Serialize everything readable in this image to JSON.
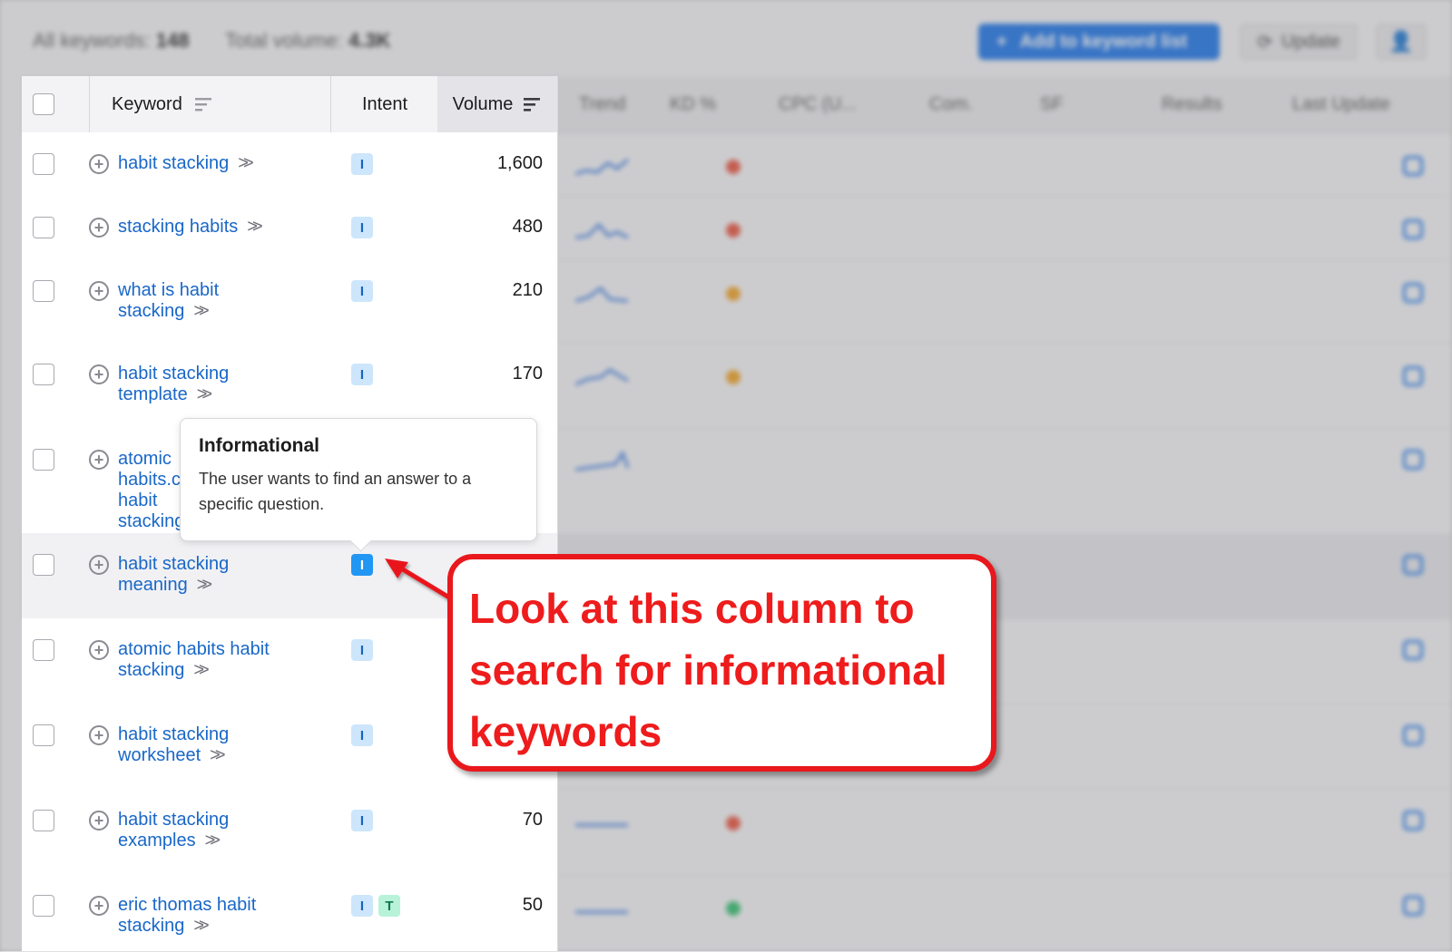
{
  "summary": {
    "label_keywords": "All keywords:",
    "value_keywords": "148",
    "label_volume": "Total volume:",
    "value_volume": "4.3K"
  },
  "toolbar": {
    "add_label": "Add to keyword list",
    "update_label": "Update"
  },
  "columns": {
    "keyword": "Keyword",
    "intent": "Intent",
    "volume": "Volume",
    "blurred": [
      "Trend",
      "KD %",
      "CPC (U...",
      "Com.",
      "SF",
      "Results",
      "Last Update"
    ]
  },
  "rows": [
    {
      "keyword": "habit stacking",
      "intents": [
        "I"
      ],
      "volume": "1,600"
    },
    {
      "keyword": "stacking habits",
      "intents": [
        "I"
      ],
      "volume": "480"
    },
    {
      "keyword": "what is habit stacking",
      "intents": [
        "I"
      ],
      "volume": "210"
    },
    {
      "keyword": "habit stacking template",
      "intents": [
        "I"
      ],
      "volume": "170"
    },
    {
      "keyword": "atomic habits.com habit stacking",
      "intents": [
        "I"
      ],
      "volume": ""
    },
    {
      "keyword": "habit stacking meaning",
      "intents": [
        "I"
      ],
      "volume": ""
    },
    {
      "keyword": "atomic habits habit stacking",
      "intents": [
        "I"
      ],
      "volume": ""
    },
    {
      "keyword": "habit stacking worksheet",
      "intents": [
        "I"
      ],
      "volume": ""
    },
    {
      "keyword": "habit stacking examples",
      "intents": [
        "I"
      ],
      "volume": "70"
    },
    {
      "keyword": "eric thomas habit stacking",
      "intents": [
        "I",
        "T"
      ],
      "volume": "50"
    }
  ],
  "tooltip": {
    "title": "Informational",
    "body": "The user wants to find an answer to a specific question."
  },
  "callout": {
    "line1": "Look at this column to",
    "line2": "search for informational",
    "line3": "keywords"
  },
  "colors": {
    "link": "#1967c8",
    "intent_informational": "#cde6fb",
    "intent_transactional": "#b8f2d8",
    "callout_red": "#e8181c"
  }
}
